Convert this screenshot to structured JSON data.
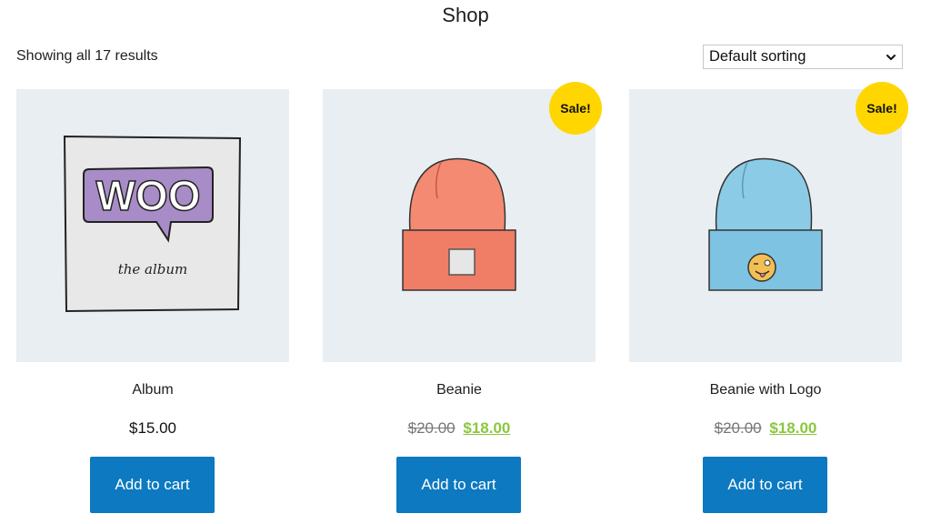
{
  "page": {
    "title": "Shop"
  },
  "results": {
    "count_text": "Showing all 17 results"
  },
  "sorting": {
    "selected": "Default sorting"
  },
  "products": [
    {
      "title": "Album",
      "price": "$15.00",
      "image": "woo-album-illustration",
      "image_text_main": "WOO",
      "image_text_sub": "the album",
      "button": "Add to cart"
    },
    {
      "title": "Beanie",
      "badge": "Sale!",
      "old_price": "$20.00",
      "new_price": "$18.00",
      "image": "orange-beanie-illustration",
      "button": "Add to cart"
    },
    {
      "title": "Beanie with Logo",
      "badge": "Sale!",
      "old_price": "$20.00",
      "new_price": "$18.00",
      "image": "blue-beanie-with-logo-illustration",
      "button": "Add to cart"
    }
  ],
  "colors": {
    "button_bg": "#0c79c0",
    "badge_bg": "#ffd600",
    "sale_price": "#8cc63f",
    "image_bg": "#e9eef2"
  }
}
